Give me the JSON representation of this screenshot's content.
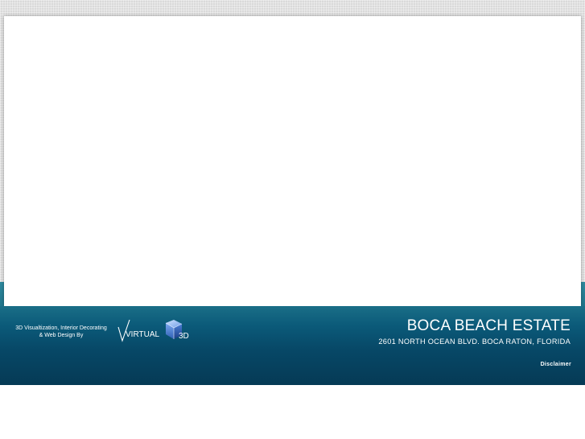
{
  "footer": {
    "credit_line1": "3D Visualtization, Interior Decorating",
    "credit_line2": "& Web Design By",
    "logo_text_left": "VIRTUAL",
    "logo_text_right": "3D",
    "estate_title": "BOCA BEACH ESTATE",
    "estate_address": "2601 NORTH OCEAN BLVD. BOCA RATON, FLORIDA",
    "disclaimer_link": "Disclaimer"
  },
  "colors": {
    "band_top": "#2f8a9f",
    "band_bottom": "#053a55",
    "logo_cube": "#5a8fd8"
  },
  "icons": {
    "logo": "virtual-3d-cube-logo"
  }
}
